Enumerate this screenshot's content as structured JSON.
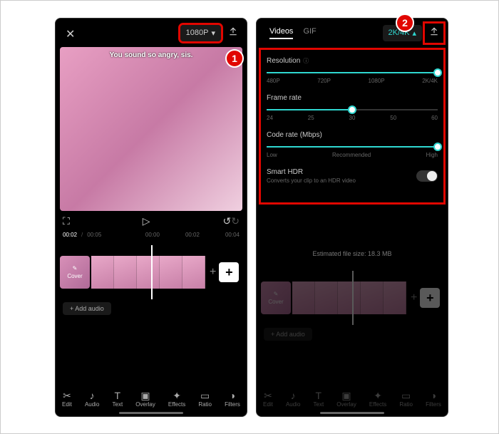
{
  "left": {
    "resolution_button": "1080P",
    "subtitle": "You sound so angry, sis.",
    "time_current": "00:02",
    "time_total": "00:05",
    "timecodes": [
      "00:00",
      "00:02",
      "00:04"
    ],
    "cover_label": "Cover",
    "add_audio": "+ Add audio",
    "tools": [
      "Edit",
      "Audio",
      "Text",
      "Overlay",
      "Effects",
      "Ratio",
      "Filters"
    ]
  },
  "right": {
    "tabs": {
      "videos": "Videos",
      "gif": "GIF"
    },
    "resolution_button": "2K/4K",
    "resolution": {
      "label": "Resolution",
      "ticks": [
        "480P",
        "720P",
        "1080P",
        "2K/4K"
      ],
      "pos": 100
    },
    "framerate": {
      "label": "Frame rate",
      "ticks": [
        "24",
        "25",
        "30",
        "50",
        "60"
      ],
      "pos": 50
    },
    "coderate": {
      "label": "Code rate (Mbps)",
      "ticks": [
        "Low",
        "Recommended",
        "High"
      ],
      "pos": 100
    },
    "smarthdr": {
      "label": "Smart HDR",
      "sub": "Converts your clip to an HDR video"
    },
    "estimate": "Estimated file size: 18.3 MB"
  },
  "steps": {
    "s1": "1",
    "s2": "2"
  }
}
